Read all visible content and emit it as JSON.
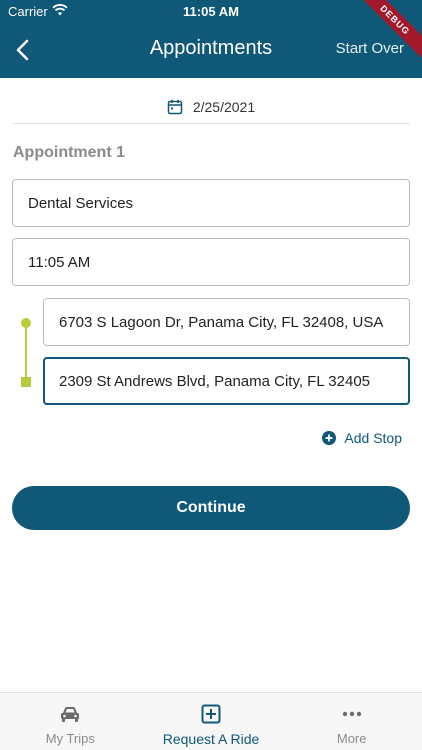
{
  "status_bar": {
    "carrier": "Carrier",
    "time": "11:05 AM"
  },
  "header": {
    "title": "Appointments",
    "start_over": "Start Over",
    "debug_banner": "DEBUG"
  },
  "date": {
    "value": "2/25/2021",
    "icon": "calendar-icon"
  },
  "appointment": {
    "title": "Appointment 1",
    "service": "Dental Services",
    "time": "11:05 AM",
    "pickup": "6703 S Lagoon Dr, Panama City, FL 32408, USA",
    "dropoff": "2309 St Andrews Blvd, Panama City, FL 32405"
  },
  "add_stop": {
    "label": "Add Stop",
    "icon": "plus-circle-icon"
  },
  "continue_label": "Continue",
  "tabs": [
    {
      "label": "My Trips",
      "icon": "car-icon",
      "active": false
    },
    {
      "label": "Request A Ride",
      "icon": "plus-square-icon",
      "active": true
    },
    {
      "label": "More",
      "icon": "more-dots-icon",
      "active": false
    }
  ],
  "colors": {
    "primary": "#0f5878",
    "route": "#b8cb3c",
    "debug": "#a3192b"
  }
}
